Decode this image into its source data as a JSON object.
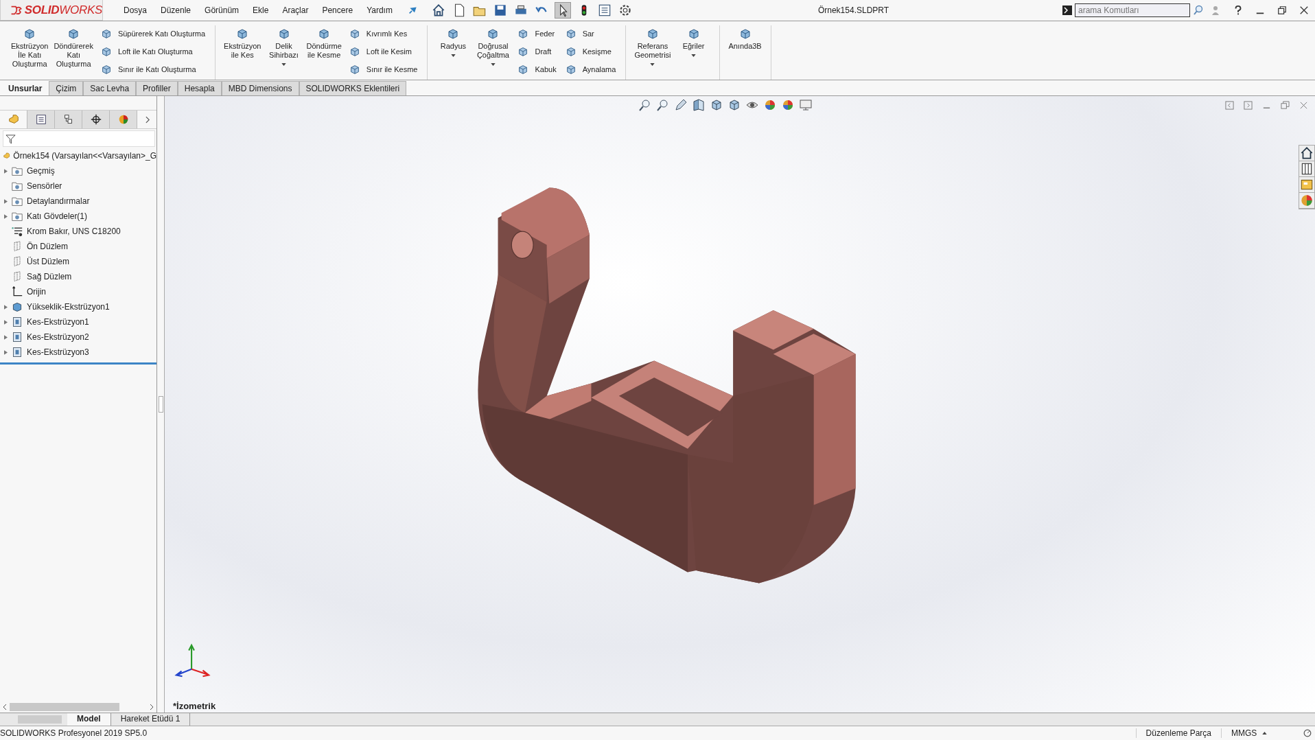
{
  "app": {
    "logo": "**SOLID**WORKS"
  },
  "menu": [
    "Dosya",
    "Düzenle",
    "Görünüm",
    "Ekle",
    "Araçlar",
    "Pencere",
    "Yardım"
  ],
  "window": {
    "title": "Örnek154.SLDPRT"
  },
  "search": {
    "placeholder": "arama Komutları"
  },
  "ribbon": {
    "groups": [
      {
        "columns": [
          {
            "kind": "large",
            "label": "Ekstrüzyon\nİle Katı\nOluşturma",
            "dropdown": false
          },
          {
            "kind": "large",
            "label": "Döndürerek\nKatı\nOluşturma",
            "dropdown": false
          },
          {
            "kind": "stack",
            "items": [
              "Süpürerek Katı Oluşturma",
              "Loft ile Katı Oluşturma",
              "Sınır ile Katı Oluşturma"
            ]
          }
        ]
      },
      {
        "columns": [
          {
            "kind": "large",
            "label": "Ekstrüzyon\nile Kes",
            "dropdown": false
          },
          {
            "kind": "large",
            "label": "Delik\nSihirbazı",
            "dropdown": true
          },
          {
            "kind": "large",
            "label": "Döndürme\nile Kesme",
            "dropdown": false
          },
          {
            "kind": "stack",
            "items": [
              "Kıvrımlı Kes",
              "Loft ile Kesim",
              "Sınır ile Kesme"
            ]
          }
        ]
      },
      {
        "columns": [
          {
            "kind": "large",
            "label": "Radyus",
            "dropdown": true
          },
          {
            "kind": "large",
            "label": "Doğrusal\nÇoğaltma",
            "dropdown": true
          },
          {
            "kind": "stack",
            "items": [
              "Feder",
              "Draft",
              "Kabuk"
            ]
          },
          {
            "kind": "stack",
            "items": [
              "Sar",
              "Kesişme",
              "Aynalama"
            ]
          }
        ]
      },
      {
        "columns": [
          {
            "kind": "large",
            "label": "Referans\nGeometrisi",
            "dropdown": true
          },
          {
            "kind": "large",
            "label": "Eğriler",
            "dropdown": true
          }
        ]
      },
      {
        "columns": [
          {
            "kind": "large",
            "label": "Anında3B",
            "dropdown": false
          }
        ]
      }
    ]
  },
  "tabs": [
    {
      "label": "Unsurlar",
      "selected": true
    },
    {
      "label": "Çizim",
      "selected": false
    },
    {
      "label": "Sac Levha",
      "selected": false
    },
    {
      "label": "Profiller",
      "selected": false
    },
    {
      "label": "Hesapla",
      "selected": false
    },
    {
      "label": "MBD Dimensions",
      "selected": false
    },
    {
      "label": "SOLIDWORKS Eklentileri",
      "selected": false
    }
  ],
  "feature_manager": {
    "panel_tabs": [
      {
        "kind": "features",
        "selected": true
      },
      {
        "kind": "properties",
        "selected": false
      },
      {
        "kind": "configurations",
        "selected": false
      },
      {
        "kind": "target",
        "selected": false
      },
      {
        "kind": "display",
        "selected": false
      }
    ],
    "tree": {
      "label": "Örnek154  (Varsayılan<<Varsayılan>_G",
      "children": [
        {
          "label": "Geçmiş",
          "kind": "folder",
          "expander": true
        },
        {
          "label": "Sensörler",
          "kind": "folder",
          "expander": false
        },
        {
          "label": "Detaylandırmalar",
          "kind": "folder",
          "expander": true
        },
        {
          "label": "Katı Gövdeler(1)",
          "kind": "folder",
          "expander": true
        },
        {
          "label": "Krom Bakır, UNS C18200",
          "kind": "material",
          "expander": false
        },
        {
          "label": "Ön Düzlem",
          "kind": "plane",
          "expander": false
        },
        {
          "label": "Üst Düzlem",
          "kind": "plane",
          "expander": false
        },
        {
          "label": "Sağ Düzlem",
          "kind": "plane",
          "expander": false
        },
        {
          "label": "Orijin",
          "kind": "origin",
          "expander": false
        },
        {
          "label": "Yükseklik-Ekstrüzyon1",
          "kind": "boss",
          "expander": true
        },
        {
          "label": "Kes-Ekstrüzyon1",
          "kind": "cut",
          "expander": true
        },
        {
          "label": "Kes-Ekstrüzyon2",
          "kind": "cut",
          "expander": true
        },
        {
          "label": "Kes-Ekstrüzyon3",
          "kind": "cut",
          "expander": true
        }
      ]
    }
  },
  "viewport": {
    "view_label": "*İzometrik"
  },
  "bottom_tabs": [
    {
      "label": "Model",
      "selected": true
    },
    {
      "label": "Hareket Etüdü 1",
      "selected": false
    }
  ],
  "status_bar": {
    "product": "SOLIDWORKS Profesyonel 2019 SP5.0",
    "mode": "Düzenleme Parça",
    "units": "MMGS"
  }
}
